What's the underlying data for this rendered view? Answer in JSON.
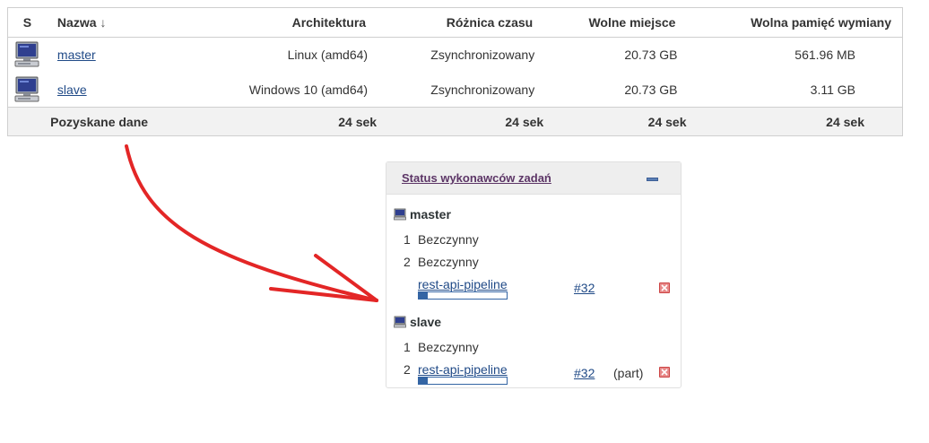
{
  "table": {
    "headers": {
      "s": "S",
      "name": "Nazwa",
      "sort_arrow": "↓",
      "arch": "Architektura",
      "time": "Różnica czasu",
      "free": "Wolne miejsce",
      "swap": "Wolna pamięć wymiany"
    },
    "rows": [
      {
        "name": "master",
        "arch": "Linux (amd64)",
        "time": "Zsynchronizowany",
        "free": "20.73 GB",
        "swap": "561.96 MB"
      },
      {
        "name": "slave",
        "arch": "Windows 10 (amd64)",
        "time": "Zsynchronizowany",
        "free": "20.73 GB",
        "swap": "3.11 GB"
      }
    ],
    "footer": {
      "label": "Pozyskane dane",
      "arch": "24 sek",
      "time": "24 sek",
      "free": "24 sek",
      "swap": "24 sek"
    }
  },
  "executors": {
    "title": "Status wykonawców zadań",
    "nodes": [
      {
        "name": "master",
        "executors": [
          {
            "num": "1",
            "status": "Bezczynny"
          },
          {
            "num": "2",
            "status": "Bezczynny"
          },
          {
            "num": "",
            "job": "rest-api-pipeline",
            "build": "#32",
            "progress": 0.1
          }
        ]
      },
      {
        "name": "slave",
        "executors": [
          {
            "num": "1",
            "status": "Bezczynny"
          },
          {
            "num": "2",
            "job": "rest-api-pipeline",
            "build": "#32",
            "part": "(part)",
            "progress": 0.1
          }
        ]
      }
    ]
  },
  "colors": {
    "arrow": "#e32626",
    "link": "#204a87",
    "progress": "#3465a4",
    "stop": "#e88a8a"
  }
}
